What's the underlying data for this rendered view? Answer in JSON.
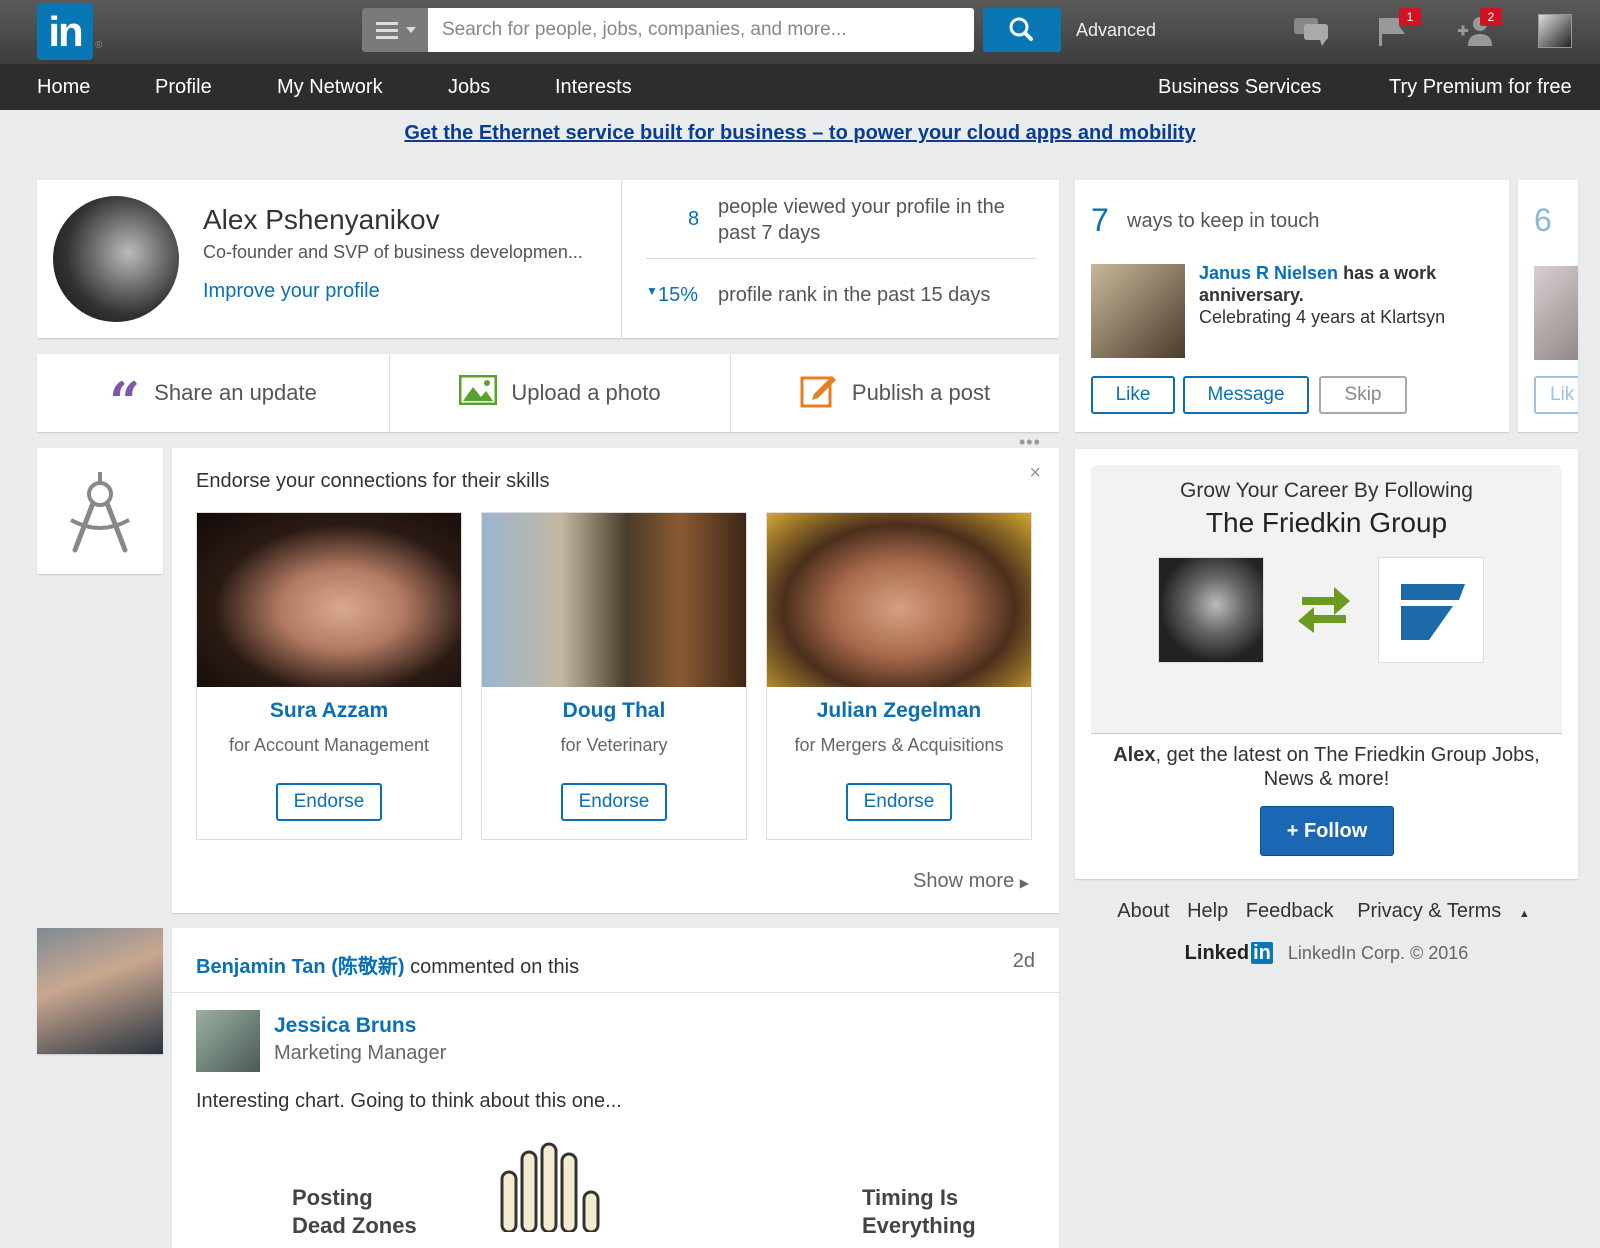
{
  "header": {
    "logo_text": "in",
    "logo_mark": "®",
    "search_placeholder": "Search for people, jobs, companies, and more...",
    "advanced_label": "Advanced",
    "messages_badge": "",
    "notifications_badge": "1",
    "invitations_badge": "2"
  },
  "nav": {
    "items": [
      "Home",
      "Profile",
      "My Network",
      "Jobs",
      "Interests"
    ],
    "business": "Business Services",
    "premium": "Try Premium for free"
  },
  "promo": {
    "text": "Get the Ethernet service built for business – to power your cloud apps and mobility"
  },
  "profile": {
    "name": "Alex Pshenyanikov",
    "title": "Co-founder and SVP of business developmen...",
    "improve": "Improve your profile",
    "views_num": "8",
    "views_text": "people viewed your profile in the past 7 days",
    "rank_num": "15%",
    "rank_text": "profile rank in the past 15 days"
  },
  "share": {
    "update": "Share an update",
    "photo": "Upload a photo",
    "post": "Publish a post"
  },
  "keep_in_touch": {
    "count": "7",
    "title": "ways to keep in touch",
    "person": "Janus R Nielsen",
    "event": "has a work anniversary.",
    "detail": "Celebrating 4 years at Klartsyn",
    "like": "Like",
    "message": "Message",
    "skip": "Skip",
    "next_count": "6",
    "next_like": "Lik"
  },
  "endorse": {
    "title": "Endorse your connections for their skills",
    "close": "×",
    "button": "Endorse",
    "show_more": "Show more",
    "people": [
      {
        "name": "Sura Azzam",
        "skill": "for Account Management"
      },
      {
        "name": "Doug Thal",
        "skill": "for Veterinary"
      },
      {
        "name": "Julian Zegelman",
        "skill": "for Mergers & Acquisitions"
      }
    ]
  },
  "follow": {
    "heading": "Grow Your Career By Following",
    "company": "The Friedkin Group",
    "user": "Alex",
    "message": ", get the latest on The Friedkin Group Jobs, News & more!",
    "button": "+ Follow"
  },
  "footer": {
    "about": "About",
    "help": "Help",
    "feedback": "Feedback",
    "privacy": "Privacy & Terms",
    "brand_text": "Linked",
    "brand_in": "in",
    "corp": "LinkedIn Corp. © 2016"
  },
  "feed": {
    "actor": "Benjamin Tan (陈敬新)",
    "action": "commented on this",
    "time": "2d",
    "author": "Jessica Bruns",
    "author_title": "Marketing Manager",
    "text": "Interesting chart. Going to think about this one...",
    "chart_left_1": "Posting",
    "chart_left_2": "Dead Zones",
    "chart_right_1": "Timing Is",
    "chart_right_2": "Everything"
  },
  "colors": {
    "brand": "#0a77b5",
    "link": "#0a70b5",
    "nav_bg": "#2d2d2d",
    "badge": "#d11124"
  }
}
